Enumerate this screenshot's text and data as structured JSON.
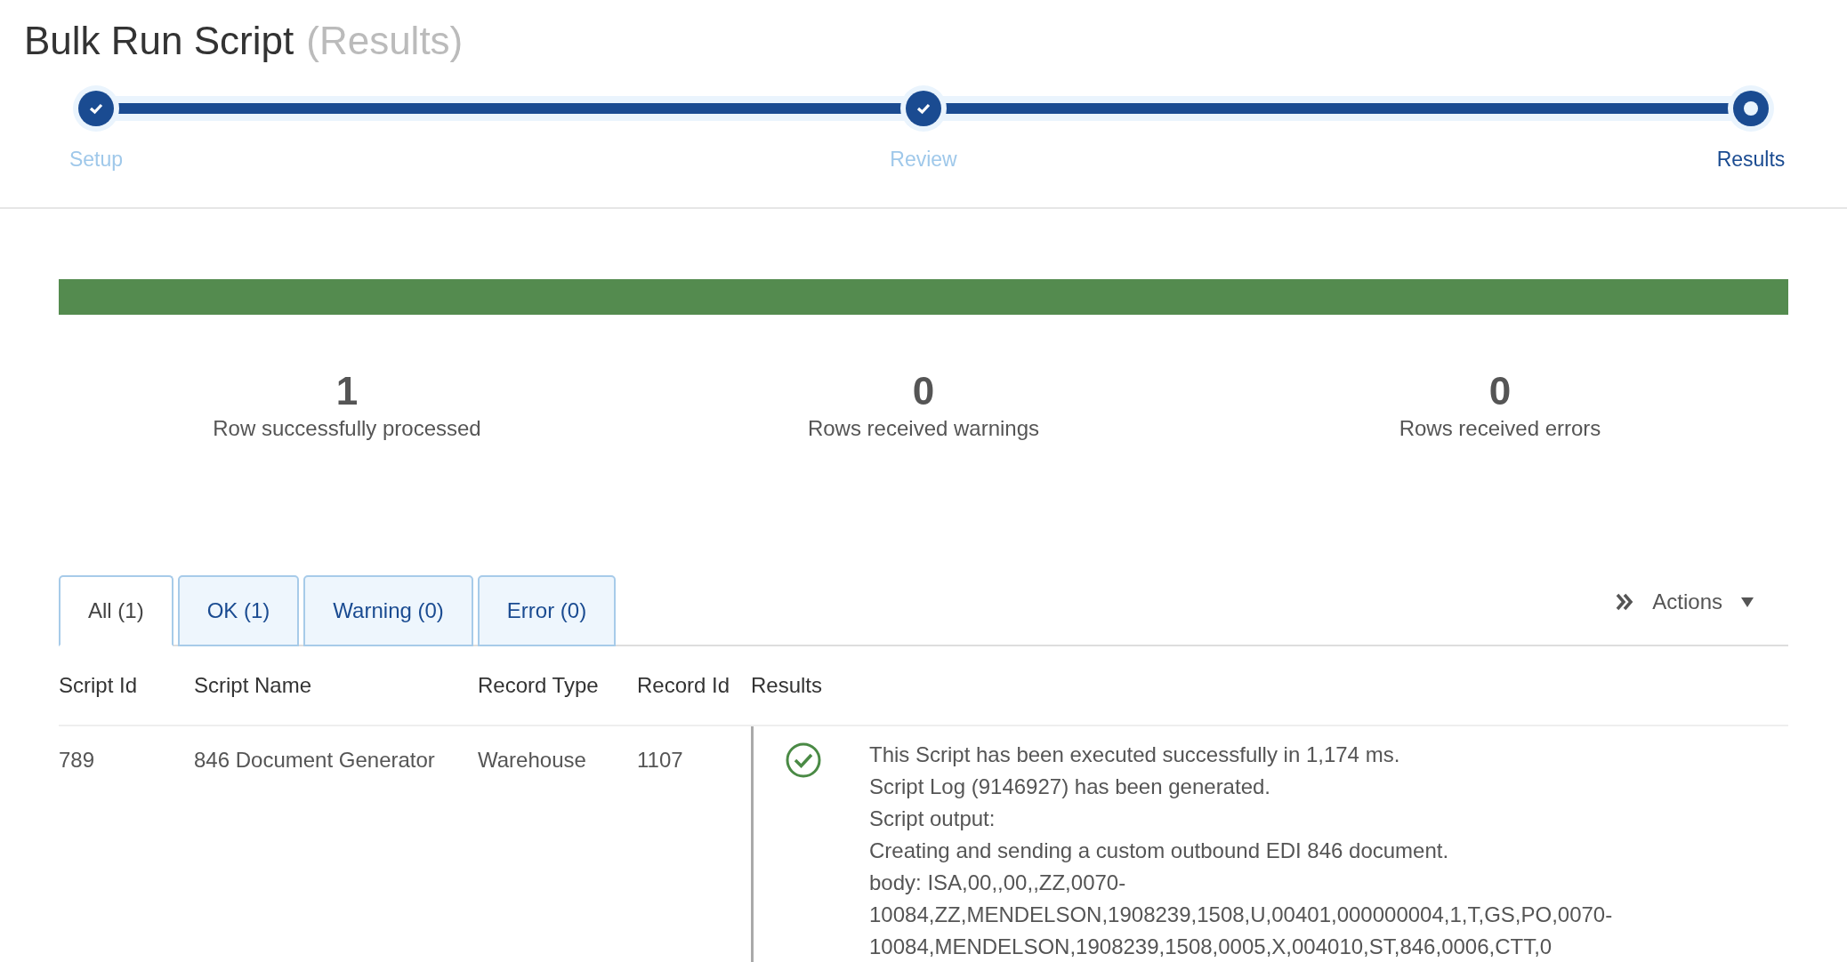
{
  "title": "Bulk Run Script",
  "subtitle": "(Results)",
  "steps": [
    {
      "label": "Setup",
      "kind": "done"
    },
    {
      "label": "Review",
      "kind": "done"
    },
    {
      "label": "Results",
      "kind": "current"
    }
  ],
  "progress": {
    "level": 1
  },
  "stats": [
    {
      "value": "1",
      "label": "Row successfully processed"
    },
    {
      "value": "0",
      "label": "Rows received warnings"
    },
    {
      "value": "0",
      "label": "Rows received errors"
    }
  ],
  "tabs": [
    {
      "label": "All (1)",
      "selected": true
    },
    {
      "label": "OK (1)",
      "selected": false
    },
    {
      "label": "Warning (0)",
      "selected": false
    },
    {
      "label": "Error (0)",
      "selected": false
    }
  ],
  "actions": {
    "label": "Actions"
  },
  "table": {
    "columns": [
      "Script Id",
      "Script Name",
      "Record Type",
      "Record Id",
      "Results"
    ],
    "rows": [
      {
        "cells": [
          "789",
          "846 Document Generator",
          "Warehouse",
          "1107"
        ],
        "kind": "ok",
        "result_lines": [
          "This Script has been executed successfully in 1,174 ms.",
          "Script Log (9146927) has been generated.",
          "Script output:",
          "Creating and sending a custom outbound EDI 846 document.",
          "body: ISA,00,,00,,ZZ,0070-",
          "10084,ZZ,MENDELSON,1908239,1508,U,00401,000000004,1,T,GS,PO,0070-",
          "10084,MENDELSON,1908239,1508,0005,X,004010,ST,846,0006,CTT,0"
        ]
      }
    ]
  }
}
